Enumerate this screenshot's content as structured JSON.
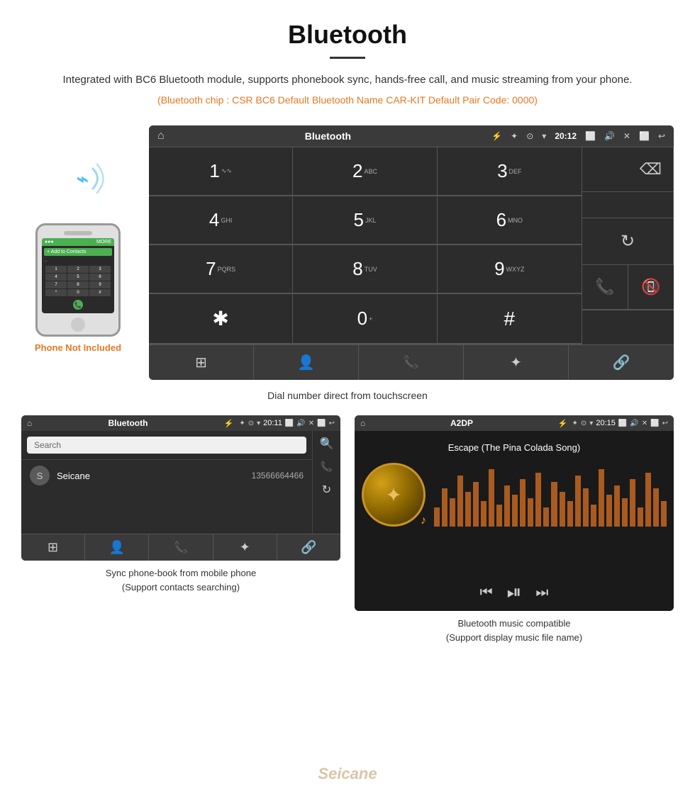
{
  "header": {
    "title": "Bluetooth",
    "description": "Integrated with BC6 Bluetooth module, supports phonebook sync, hands-free call, and music streaming from your phone.",
    "specs": "(Bluetooth chip : CSR BC6    Default Bluetooth Name CAR-KIT    Default Pair Code: 0000)"
  },
  "phone_mockup": {
    "not_included_label": "Phone Not Included"
  },
  "car_screen": {
    "statusbar": {
      "title": "Bluetooth",
      "time": "20:12"
    },
    "keypad": [
      {
        "num": "1",
        "sub": "∿∿"
      },
      {
        "num": "2",
        "sub": "ABC"
      },
      {
        "num": "3",
        "sub": "DEF"
      },
      {
        "num": "",
        "sub": ""
      },
      {
        "num": "⌫",
        "sub": ""
      },
      {
        "num": "4",
        "sub": "GHI"
      },
      {
        "num": "5",
        "sub": "JKL"
      },
      {
        "num": "6",
        "sub": "MNO"
      },
      {
        "num": "",
        "sub": ""
      },
      {
        "num": "",
        "sub": ""
      },
      {
        "num": "7",
        "sub": "PQRS"
      },
      {
        "num": "8",
        "sub": "TUV"
      },
      {
        "num": "9",
        "sub": "WXYZ"
      },
      {
        "num": "",
        "sub": ""
      },
      {
        "num": "↻",
        "sub": ""
      },
      {
        "num": "✱",
        "sub": ""
      },
      {
        "num": "0",
        "sub": "+"
      },
      {
        "num": "#",
        "sub": ""
      },
      {
        "num": "📞",
        "sub": ""
      },
      {
        "num": "📵",
        "sub": ""
      }
    ]
  },
  "caption_main": "Dial number direct from touchscreen",
  "phonebook_screen": {
    "statusbar": {
      "title": "Bluetooth",
      "time": "20:11"
    },
    "search_placeholder": "Search",
    "contact": {
      "initial": "S",
      "name": "Seicane",
      "number": "13566664466"
    }
  },
  "caption_phonebook": "Sync phone-book from mobile phone\n(Support contacts searching)",
  "music_screen": {
    "statusbar": {
      "title": "A2DP",
      "time": "20:15"
    },
    "song_title": "Escape (The Pina Colada Song)"
  },
  "caption_music": "Bluetooth music compatible\n(Support display music file name)",
  "eq_bars": [
    30,
    60,
    45,
    80,
    55,
    70,
    40,
    90,
    35,
    65,
    50,
    75,
    45,
    85,
    30,
    70,
    55,
    40,
    80,
    60,
    35,
    90,
    50,
    65,
    45,
    75,
    30,
    85,
    60,
    40
  ]
}
